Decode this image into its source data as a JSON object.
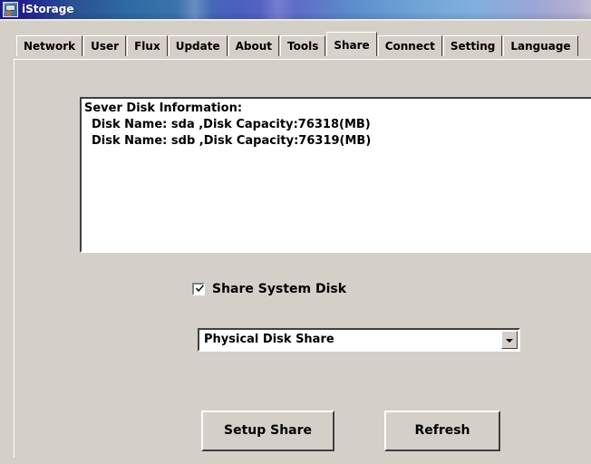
{
  "window": {
    "title": "iStorage",
    "icon": "storage-user-icon"
  },
  "tabs": [
    {
      "label": "Network",
      "selected": false
    },
    {
      "label": "User",
      "selected": false
    },
    {
      "label": "Flux",
      "selected": false
    },
    {
      "label": "Update",
      "selected": false
    },
    {
      "label": "About",
      "selected": false
    },
    {
      "label": "Tools",
      "selected": false
    },
    {
      "label": "Share",
      "selected": true
    },
    {
      "label": "Connect",
      "selected": false
    },
    {
      "label": "Setting",
      "selected": false
    },
    {
      "label": "Language",
      "selected": false
    }
  ],
  "share_panel": {
    "disk_info": {
      "heading": "Sever Disk Information:",
      "lines": [
        "Disk Name: sda ,Disk Capacity:76318(MB)",
        "Disk Name: sdb ,Disk Capacity:76319(MB)"
      ]
    },
    "share_system_disk": {
      "label": "Share System Disk",
      "checked": true
    },
    "share_mode": {
      "value": "Physical Disk Share"
    },
    "buttons": {
      "setup_share": "Setup Share",
      "refresh": "Refresh"
    }
  },
  "colors": {
    "window_face": "#d4d0c8",
    "field_bg": "#ffffff",
    "text": "#000000",
    "title_text": "#ffffff",
    "shadow": "#404040",
    "highlight": "#ffffff"
  }
}
